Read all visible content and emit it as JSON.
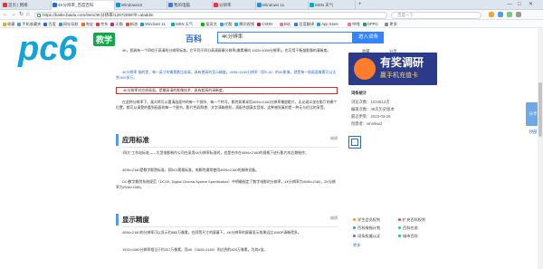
{
  "browser": {
    "tabs": [
      {
        "label": "首页 | 网络",
        "color": "#e33"
      },
      {
        "label": "4K分辨率_百度百科",
        "color": "#2b6ad6",
        "active": true
      },
      {
        "label": "Windows10",
        "color": "#1a8fd6"
      },
      {
        "label": "我的电脑",
        "color": "#3a7bd5"
      },
      {
        "label": "分辨率",
        "color": "#e34"
      },
      {
        "label": "Windows 11",
        "color": "#2b8fe0"
      },
      {
        "label": "MSN 天气",
        "color": "#1ab"
      }
    ],
    "window_controls": [
      "—",
      "□",
      "✕"
    ],
    "url": "https://baike.baidu.com/item/4K分辨率/12572059?fr=aladdin",
    "search_placeholder": "百度一下",
    "bookmarks": [
      "收藏",
      "手机收藏夹",
      "百度",
      "网址导航",
      "淘宝",
      "京东",
      "天猫",
      "新浪",
      "Windows 11",
      "MSN 天气",
      "爱奇艺",
      "优酷",
      "腾讯视频",
      "CSDN",
      "B站",
      "百度翻译",
      "App Store",
      "哔哩",
      "OPPO",
      "更多"
    ]
  },
  "baike": {
    "logo_text": "百科",
    "search_value": "4K分辨率",
    "search_button": "进入词条"
  },
  "overlay": {
    "logo_text": "pc6",
    "badge": "教学"
  },
  "content": {
    "intro": [
      "4K，即具有一个四倍于高清的分辨率标准。它不同于四分高清屏幕分辨率(像素横向 1920×1080分辨率)，也可用于衡量影像的清晰度。",
      "4K分辨率 指的是，每一英寸的像素数比较高，具有更高的显示精度。4096×2160分辨率（即9:16）的4K影像，就是每一帧画面像素可以达到 800多万。",
      "4K分辨率对应原画面，是最高清的影像技术…具有超高的清晰度。",
      "在此种分辨率下，观众将可以看清画面中的每一个细节、每一个特写。影院如果采用4096×2160分辨率播放影片，无论观众坐在影厅的哪个位置，都可以清楚的看到画面的每一个细节，影片色彩鲜艳、文字清晰锐利，再配合超真实音效，这种感觉真的是一种无与伦比的享受。"
    ],
    "section1": {
      "title": "应用标准",
      "edit": "编辑"
    },
    "std": [
      "“四大”工作站标准——大型电影制作公司在采用4K分辨率标准时，也是合作在4096×2160的规格下进行影片的后期制作；",
      "4096×2160是数字影院标准，即DCI规格标准，电影院通常使用4096×2160的放映设备。",
      "DCI数字影院系统规范（DCSS, Digital Cinema System Specification）中明确规定了数字电影的分辨率，4K分辨率为4096×2160，2K分辨率为2048×1080。"
    ],
    "section2": {
      "title": "显示精度",
      "edit": "编辑"
    },
    "disp": [
      "4096×2160的分辨率可以显示约885万像素，在同等尺寸的屏幕下，4K分辨率的屏幕显示效果远比1080P清晰得多。",
      "1920×1080分辨率相当于约207万像素，而4K（3840×2160）则达到约829万像素，为其4倍。"
    ]
  },
  "sidebar": {
    "header_links": [
      "收藏",
      "分享"
    ],
    "ad": {
      "title": "有奖调研",
      "sub": "赢手机充值卡"
    },
    "rows": [
      "词条统计",
      "浏览次数：1034612次",
      "编辑次数：49次历史版本",
      "最近更新：2023-03-28",
      "创建者：wnmkwd"
    ],
    "tags": [
      "学生会员权利",
      "扩充百科权利",
      "百科拇指计划",
      "百科任务",
      "词条权威认证",
      "城市百科"
    ],
    "more_label": "更多"
  },
  "share": {
    "label": "分享",
    "top": "顶部"
  }
}
